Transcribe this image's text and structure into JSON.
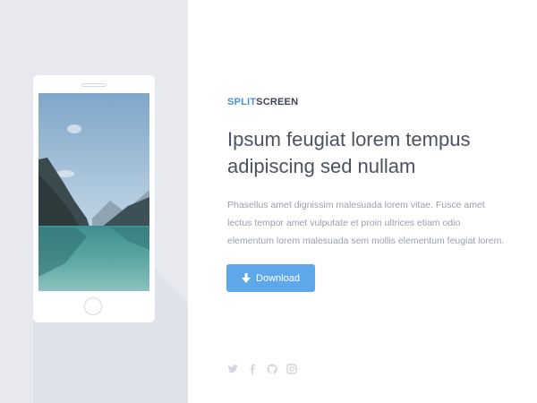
{
  "brand": {
    "accent": "SPLIT",
    "rest": "SCREEN"
  },
  "headline": "Ipsum feugiat lorem tempus adipiscing sed nullam",
  "description": "Phasellus amet dignissim malesuada lorem vitae. Fusce amet lectus tempor amet vulputate et proin ultrices etiam odio elementum lorem malesuada sem mollis elementum feugiat lorem.",
  "download_button": {
    "label": "Download",
    "icon": "download-arrow-icon"
  },
  "social_icons": [
    "twitter-icon",
    "facebook-icon",
    "github-icon",
    "instagram-icon"
  ],
  "colors": {
    "accent": "#4a90d9",
    "button": "#5ea7e8",
    "left_panel_bg": "#e7e9ee",
    "heading": "#4d5261",
    "body_text": "#9a9fab"
  }
}
